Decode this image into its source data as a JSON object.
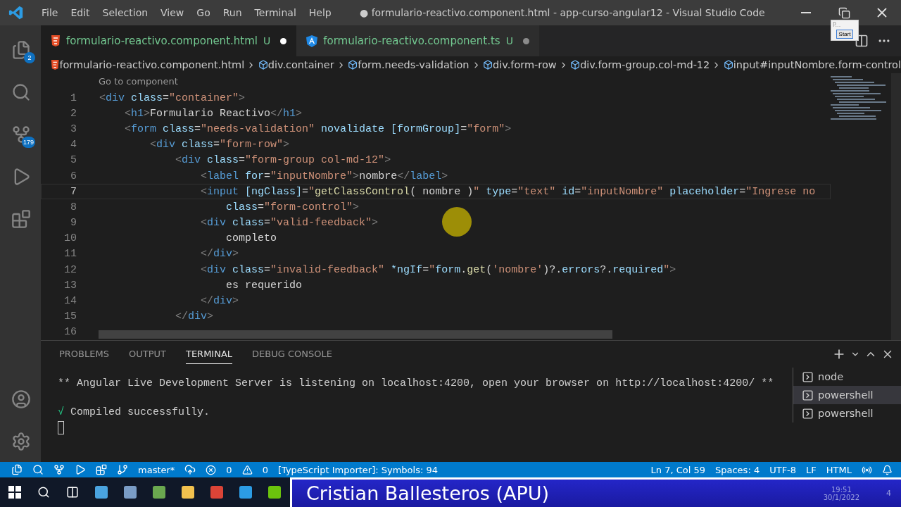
{
  "window": {
    "title": "● formulario-reactivo.component.html - app-curso-angular12 - Visual Studio Code"
  },
  "menu": [
    "File",
    "Edit",
    "Selection",
    "View",
    "Go",
    "Run",
    "Terminal",
    "Help"
  ],
  "activity_bar": [
    {
      "kind": "files",
      "badge": "2",
      "selected": false
    },
    {
      "kind": "search",
      "selected": false
    },
    {
      "kind": "source-control",
      "badge": "179",
      "selected": false
    },
    {
      "kind": "debug",
      "selected": false
    },
    {
      "kind": "extensions",
      "selected": false
    }
  ],
  "tabs": [
    {
      "label": "formulario-reactivo.component.html",
      "kind": "html",
      "status": "U",
      "dirty": true,
      "selected": true
    },
    {
      "label": "formulario-reactivo.component.ts",
      "kind": "angular",
      "status": "U",
      "dirty": true,
      "selected": false
    }
  ],
  "popup": {
    "title": "P...",
    "button": "Start"
  },
  "breadcrumbs": [
    {
      "label": "formulario-reactivo.component.html",
      "kind": "html"
    },
    {
      "label": "div.container",
      "kind": "element"
    },
    {
      "label": "form.needs-validation",
      "kind": "element"
    },
    {
      "label": "div.form-row",
      "kind": "element"
    },
    {
      "label": "div.form-group.col-md-12",
      "kind": "element"
    },
    {
      "label": "input#inputNombre.form-control",
      "kind": "element"
    }
  ],
  "codelens": "Go to component",
  "code": [
    {
      "n": "1",
      "current": false,
      "tokens": [
        {
          "kind": "p",
          "t": "<"
        },
        {
          "kind": "t",
          "t": "div"
        },
        {
          "kind": "a",
          "t": " class"
        },
        {
          "kind": "x",
          "t": "="
        },
        {
          "kind": "s",
          "t": "\"container\""
        },
        {
          "kind": "p",
          "t": ">"
        }
      ]
    },
    {
      "n": "2",
      "current": false,
      "tokens": [
        {
          "kind": "p",
          "t": "    <"
        },
        {
          "kind": "t",
          "t": "h1"
        },
        {
          "kind": "p",
          "t": ">"
        },
        {
          "kind": "x",
          "t": "Formulario Reactivo"
        },
        {
          "kind": "p",
          "t": "</"
        },
        {
          "kind": "t",
          "t": "h1"
        },
        {
          "kind": "p",
          "t": ">"
        }
      ]
    },
    {
      "n": "3",
      "current": false,
      "tokens": [
        {
          "kind": "p",
          "t": "    <"
        },
        {
          "kind": "t",
          "t": "form"
        },
        {
          "kind": "a",
          "t": " class"
        },
        {
          "kind": "x",
          "t": "="
        },
        {
          "kind": "s",
          "t": "\"needs-validation\""
        },
        {
          "kind": "a",
          "t": " novalidate [formGroup]"
        },
        {
          "kind": "x",
          "t": "="
        },
        {
          "kind": "s",
          "t": "\"form\""
        },
        {
          "kind": "p",
          "t": ">"
        }
      ]
    },
    {
      "n": "4",
      "current": false,
      "tokens": [
        {
          "kind": "p",
          "t": "        <"
        },
        {
          "kind": "t",
          "t": "div"
        },
        {
          "kind": "a",
          "t": " class"
        },
        {
          "kind": "x",
          "t": "="
        },
        {
          "kind": "s",
          "t": "\"form-row\""
        },
        {
          "kind": "p",
          "t": ">"
        }
      ]
    },
    {
      "n": "5",
      "current": false,
      "tokens": [
        {
          "kind": "p",
          "t": "            <"
        },
        {
          "kind": "t",
          "t": "div"
        },
        {
          "kind": "a",
          "t": " class"
        },
        {
          "kind": "x",
          "t": "="
        },
        {
          "kind": "s",
          "t": "\"form-group col-md-12\""
        },
        {
          "kind": "p",
          "t": ">"
        }
      ]
    },
    {
      "n": "6",
      "current": false,
      "tokens": [
        {
          "kind": "p",
          "t": "                <"
        },
        {
          "kind": "t",
          "t": "label"
        },
        {
          "kind": "a",
          "t": " for"
        },
        {
          "kind": "x",
          "t": "="
        },
        {
          "kind": "s",
          "t": "\"inputNombre\""
        },
        {
          "kind": "p",
          "t": ">"
        },
        {
          "kind": "x",
          "t": "nombre"
        },
        {
          "kind": "p",
          "t": "</"
        },
        {
          "kind": "t",
          "t": "label"
        },
        {
          "kind": "p",
          "t": ">"
        }
      ]
    },
    {
      "n": "7",
      "current": true,
      "tokens": [
        {
          "kind": "p",
          "t": "                <"
        },
        {
          "kind": "t",
          "t": "input"
        },
        {
          "kind": "a",
          "t": " [ngClass]"
        },
        {
          "kind": "x",
          "t": "="
        },
        {
          "kind": "s",
          "t": "\""
        },
        {
          "kind": "f",
          "t": "getClassControl"
        },
        {
          "kind": "x",
          "t": "( nombre )"
        },
        {
          "kind": "s",
          "t": "\""
        },
        {
          "kind": "a",
          "t": " type"
        },
        {
          "kind": "x",
          "t": "="
        },
        {
          "kind": "s",
          "t": "\"text\""
        },
        {
          "kind": "a",
          "t": " id"
        },
        {
          "kind": "x",
          "t": "="
        },
        {
          "kind": "s",
          "t": "\"inputNombre\""
        },
        {
          "kind": "a",
          "t": " placeholder"
        },
        {
          "kind": "x",
          "t": "="
        },
        {
          "kind": "s",
          "t": "\"Ingrese no"
        }
      ]
    },
    {
      "n": "8",
      "current": false,
      "tokens": [
        {
          "kind": "a",
          "t": "                    class"
        },
        {
          "kind": "x",
          "t": "="
        },
        {
          "kind": "s",
          "t": "\"form-control\""
        },
        {
          "kind": "p",
          "t": ">"
        }
      ]
    },
    {
      "n": "9",
      "current": false,
      "tokens": [
        {
          "kind": "p",
          "t": "                <"
        },
        {
          "kind": "t",
          "t": "div"
        },
        {
          "kind": "a",
          "t": " class"
        },
        {
          "kind": "x",
          "t": "="
        },
        {
          "kind": "s",
          "t": "\"valid-feedback\""
        },
        {
          "kind": "p",
          "t": ">"
        }
      ]
    },
    {
      "n": "10",
      "current": false,
      "tokens": [
        {
          "kind": "x",
          "t": "                    completo"
        }
      ]
    },
    {
      "n": "11",
      "current": false,
      "tokens": [
        {
          "kind": "p",
          "t": "                </"
        },
        {
          "kind": "t",
          "t": "div"
        },
        {
          "kind": "p",
          "t": ">"
        }
      ]
    },
    {
      "n": "12",
      "current": false,
      "tokens": [
        {
          "kind": "p",
          "t": "                <"
        },
        {
          "kind": "t",
          "t": "div"
        },
        {
          "kind": "a",
          "t": " class"
        },
        {
          "kind": "x",
          "t": "="
        },
        {
          "kind": "s",
          "t": "\"invalid-feedback\""
        },
        {
          "kind": "a",
          "t": " *ngIf"
        },
        {
          "kind": "x",
          "t": "="
        },
        {
          "kind": "s",
          "t": "\""
        },
        {
          "kind": "a",
          "t": "form"
        },
        {
          "kind": "x",
          "t": "."
        },
        {
          "kind": "f",
          "t": "get"
        },
        {
          "kind": "x",
          "t": "("
        },
        {
          "kind": "s",
          "t": "'nombre'"
        },
        {
          "kind": "x",
          "t": ")?."
        },
        {
          "kind": "a",
          "t": "errors"
        },
        {
          "kind": "x",
          "t": "?."
        },
        {
          "kind": "a",
          "t": "required"
        },
        {
          "kind": "s",
          "t": "\""
        },
        {
          "kind": "p",
          "t": ">"
        }
      ]
    },
    {
      "n": "13",
      "current": false,
      "tokens": [
        {
          "kind": "x",
          "t": "                    es requerido"
        }
      ]
    },
    {
      "n": "14",
      "current": false,
      "tokens": [
        {
          "kind": "p",
          "t": "                </"
        },
        {
          "kind": "t",
          "t": "div"
        },
        {
          "kind": "p",
          "t": ">"
        }
      ]
    },
    {
      "n": "15",
      "current": false,
      "tokens": [
        {
          "kind": "p",
          "t": "            </"
        },
        {
          "kind": "t",
          "t": "div"
        },
        {
          "kind": "p",
          "t": ">"
        }
      ]
    },
    {
      "n": "16",
      "current": false
    }
  ],
  "panel": {
    "tabs": [
      {
        "label": "PROBLEMS",
        "selected": false
      },
      {
        "label": "OUTPUT",
        "selected": false
      },
      {
        "label": "TERMINAL",
        "selected": true
      },
      {
        "label": "DEBUG CONSOLE",
        "selected": false
      }
    ],
    "terminal_lines": [
      {
        "kind": "plain",
        "text": "** Angular Live Development Server is listening on localhost:4200, open your browser on http://localhost:4200/ **"
      },
      {
        "kind": "success",
        "mark": "√",
        "text": "Compiled successfully."
      }
    ],
    "terminals": [
      {
        "label": "node",
        "selected": false
      },
      {
        "label": "powershell",
        "selected": true
      },
      {
        "label": "powershell",
        "selected": false
      }
    ]
  },
  "status_bar": {
    "branch": "master*",
    "errors": "0",
    "warnings": "0",
    "message": "[TypeScript Importer]: Symbols: 94",
    "right": [
      "Ln 7, Col 59",
      "Spaces: 4",
      "UTF-8",
      "LF",
      "HTML"
    ]
  },
  "banner": {
    "name": "Cristian Ballesteros (APU)",
    "time": "19:51",
    "date": "30/1/2022",
    "notifications": "4"
  }
}
